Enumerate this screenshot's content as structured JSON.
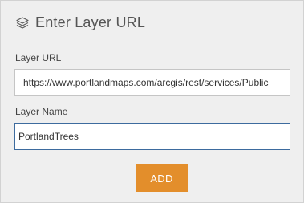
{
  "header": {
    "title": "Enter Layer URL",
    "icon": "layers-icon"
  },
  "form": {
    "url_label": "Layer URL",
    "url_value": "https://www.portlandmaps.com/arcgis/rest/services/Public",
    "name_label": "Layer Name",
    "name_value": "PortlandTrees"
  },
  "actions": {
    "add_label": "ADD",
    "add_color": "#e38e2b"
  },
  "colors": {
    "panel_background": "#efefef",
    "focused_border": "#3d6b9e"
  }
}
